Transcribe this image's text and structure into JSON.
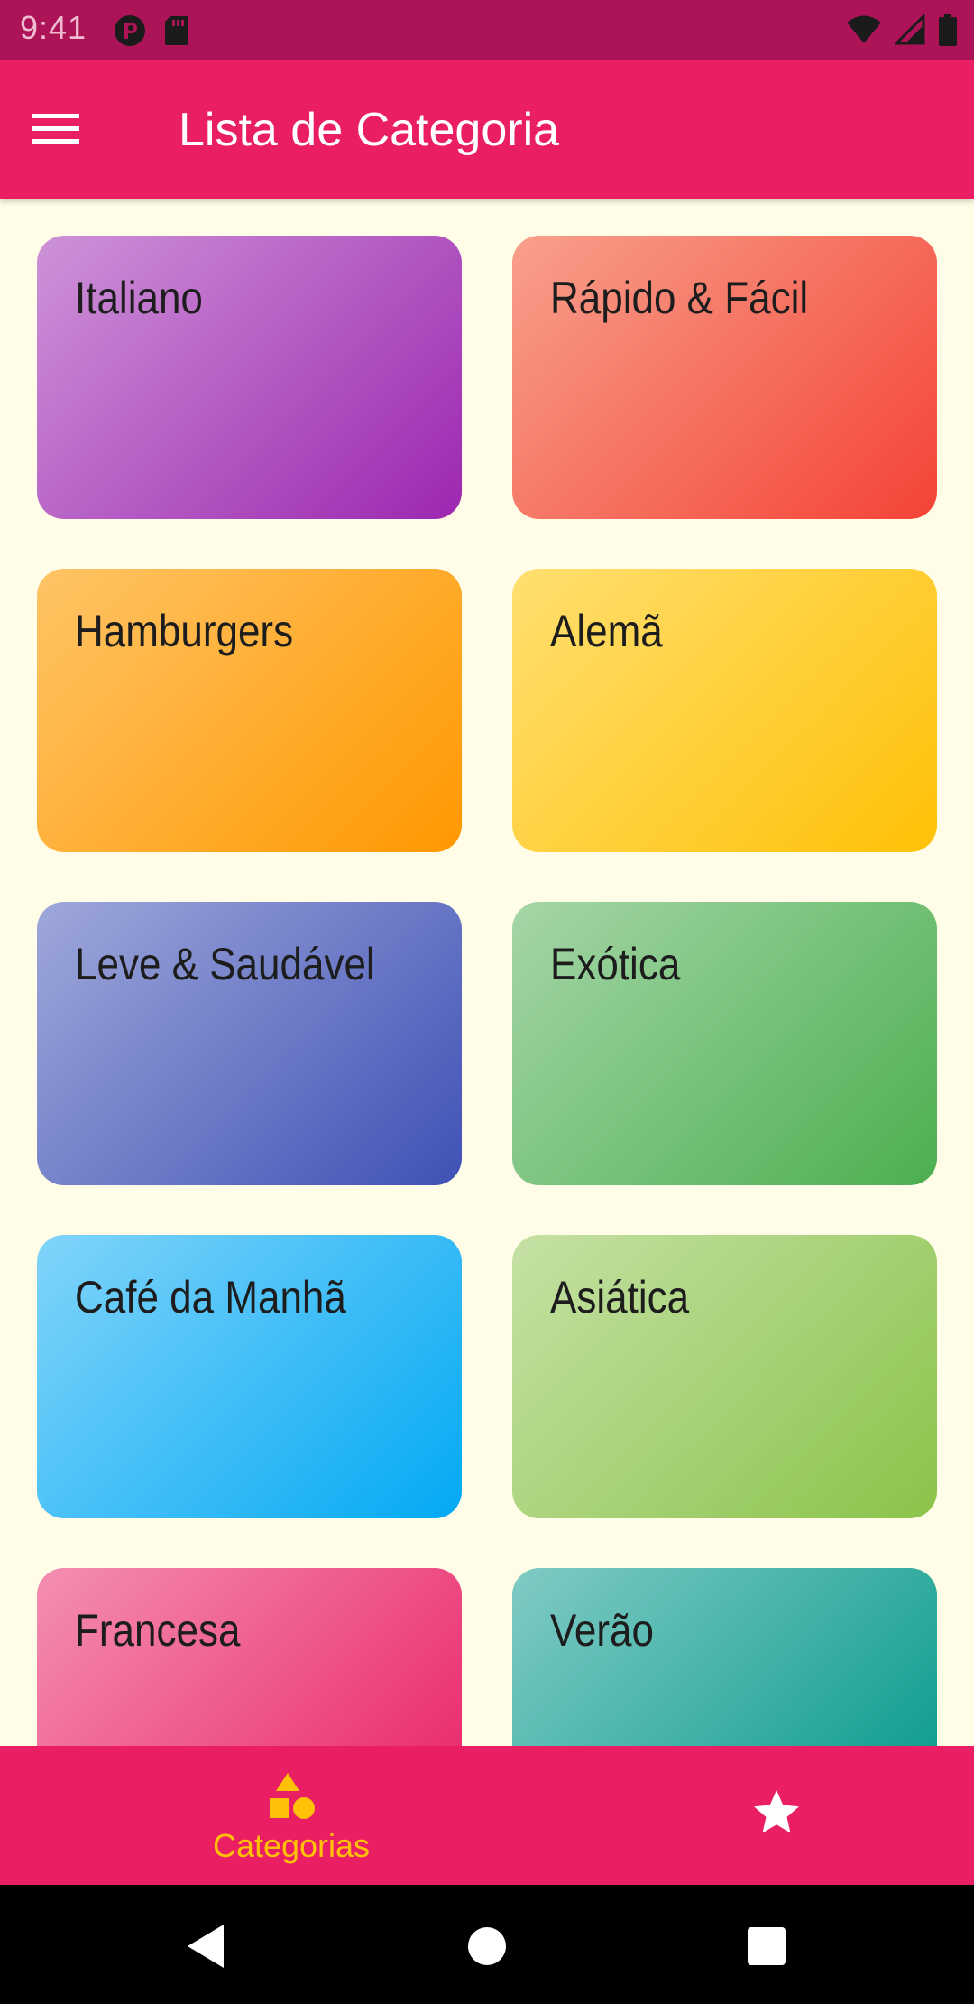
{
  "status_bar": {
    "time": "9:41"
  },
  "app_bar": {
    "title": "Lista de Categoria",
    "menu_icon": "menu-icon"
  },
  "categories": [
    {
      "label": "Italiano",
      "color_start": "#CE93D8",
      "color_end": "#9C27B0"
    },
    {
      "label": "Rápido & Fácil",
      "color_start": "#F8A08C",
      "color_end": "#F44336"
    },
    {
      "label": "Hamburgers",
      "color_start": "#FFC466",
      "color_end": "#FF9800"
    },
    {
      "label": "Alemã",
      "color_start": "#FFDF70",
      "color_end": "#FFC107"
    },
    {
      "label": "Leve & Saudável",
      "color_start": "#9FA8DA",
      "color_end": "#3F51B5"
    },
    {
      "label": "Exótica",
      "color_start": "#A5D6A7",
      "color_end": "#4CAF50"
    },
    {
      "label": "Café da Manhã",
      "color_start": "#81D4FA",
      "color_end": "#03A9F4"
    },
    {
      "label": "Asiática",
      "color_start": "#C5E1A5",
      "color_end": "#8BC34A"
    },
    {
      "label": "Francesa",
      "color_start": "#F48FB1",
      "color_end": "#E91E63"
    },
    {
      "label": "Verão",
      "color_start": "#80CBC4",
      "color_end": "#009688"
    }
  ],
  "bottom_nav": {
    "categorias_label": "Categorias",
    "categorias_icon": "category-shapes-icon",
    "favoritos_icon": "star-icon",
    "active_color": "#FFC107"
  },
  "colors": {
    "primary": "#E91E63",
    "primary_dark": "#AD1457",
    "background": "#FFFDE7",
    "accent": "#FFC107"
  }
}
